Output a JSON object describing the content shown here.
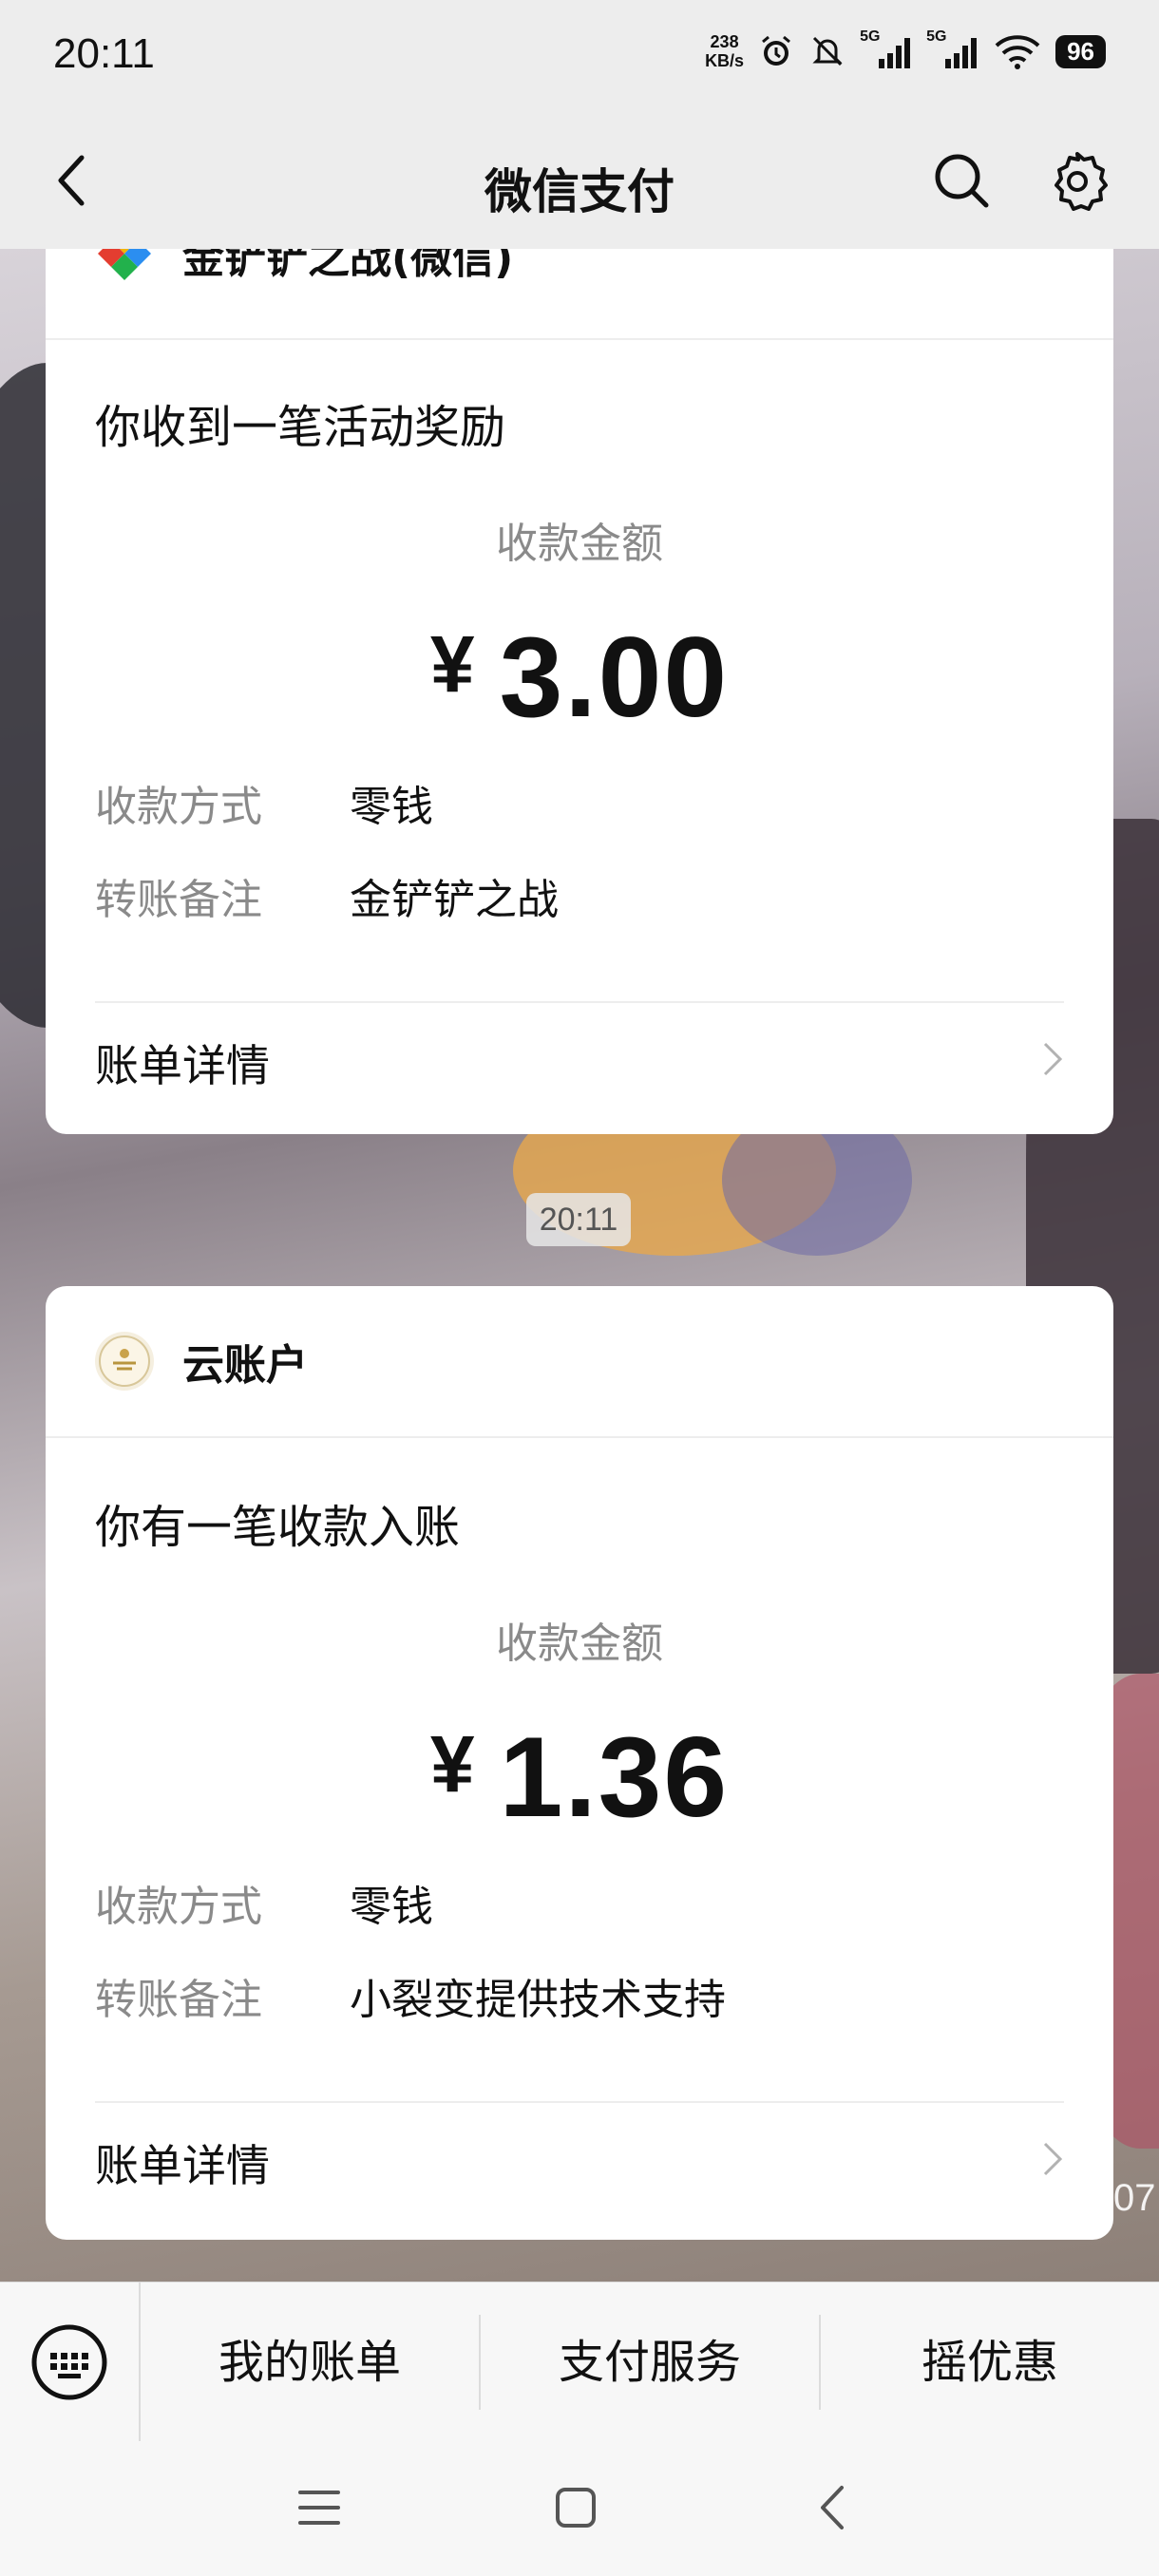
{
  "status_bar": {
    "time": "20:11",
    "net_speed_value": "238",
    "net_speed_unit": "KB/s",
    "signal1": "5G",
    "signal2": "5G",
    "battery": "96"
  },
  "nav": {
    "title": "微信支付",
    "back_icon": "back-chevron-icon",
    "search_icon": "search-icon",
    "settings_icon": "gear-icon"
  },
  "messages": [
    {
      "app_name": "金铲铲之战(微信)",
      "title": "你收到一笔活动奖励",
      "amount_label": "收款金额",
      "currency": "¥",
      "amount": "3.00",
      "rows": [
        {
          "label": "收款方式",
          "value": "零钱"
        },
        {
          "label": "转账备注",
          "value": "金铲铲之战"
        }
      ],
      "detail_label": "账单详情"
    },
    {
      "app_name": "云账户",
      "title": "你有一笔收款入账",
      "amount_label": "收款金额",
      "currency": "¥",
      "amount": "1.36",
      "rows": [
        {
          "label": "收款方式",
          "value": "零钱"
        },
        {
          "label": "转账备注",
          "value": "小裂变提供技术支持"
        }
      ],
      "detail_label": "账单详情"
    }
  ],
  "timestamp": "20:11",
  "overlay_text": "07",
  "bottom_menu": {
    "items": [
      "我的账单",
      "支付服务",
      "摇优惠"
    ]
  },
  "colors": {
    "page_bg": "#ededed",
    "card_bg": "#ffffff",
    "muted_text": "#8a8a8a"
  }
}
